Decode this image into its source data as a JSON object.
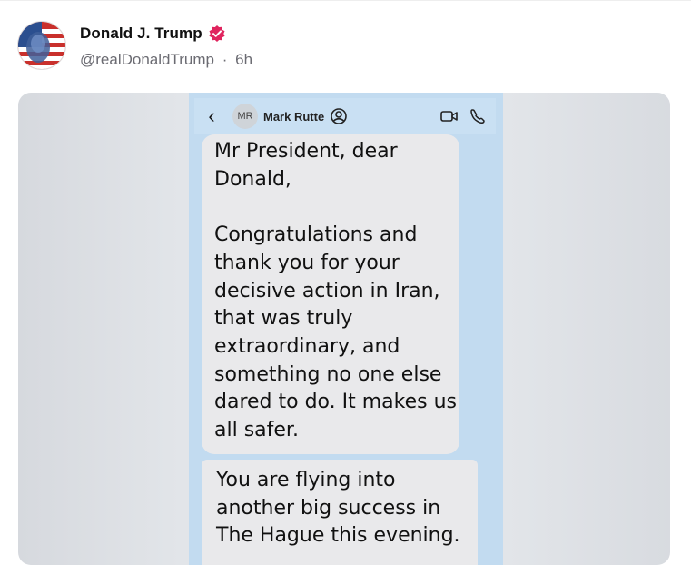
{
  "post": {
    "author_name": "Donald J. Trump",
    "handle": "@realDonaldTrump",
    "separator": "·",
    "time": "6h"
  },
  "screenshot": {
    "back_glyph": "‹",
    "contact_initials": "MR",
    "contact_name": "Mark Rutte",
    "icons": [
      "back-chevron-icon",
      "contact-info-icon",
      "video-call-icon",
      "phone-call-icon"
    ],
    "message1_lines": [
      "Mr President, dear",
      "Donald,",
      "",
      "Congratulations and",
      "thank you for your",
      "decisive action in Iran,",
      "that was truly",
      "extraordinary, and",
      "something no one else",
      "dared to do.  It makes us",
      "all safer."
    ],
    "message2_lines": [
      "You are flying into",
      "another big success in",
      "The Hague this evening."
    ]
  },
  "colors": {
    "verified_badge": "#e0245e",
    "chat_background": "#c2dbf0",
    "bubble": "#e9e9eb"
  }
}
